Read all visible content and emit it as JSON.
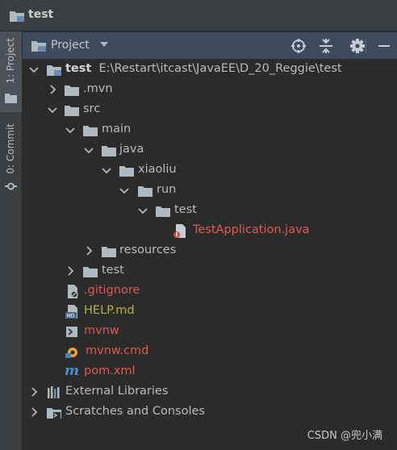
{
  "window": {
    "title": "test"
  },
  "sidebar": {
    "project_tab": "1: Project",
    "commit_tab": "0: Commit"
  },
  "panel": {
    "title": "Project"
  },
  "tree": {
    "root": {
      "label": "test",
      "path": "E:\\Restart\\itcast\\JavaEE\\D_20_Reggie\\test"
    },
    "mvn": ".mvn",
    "src": "src",
    "main": "main",
    "java": "java",
    "xiaoliu": "xiaoliu",
    "run": "run",
    "test_pkg": "test",
    "test_app": "TestApplication.java",
    "resources": "resources",
    "test_dir": "test",
    "gitignore": ".gitignore",
    "help": "HELP.md",
    "mvnw": "mvnw",
    "mvnw_cmd": "mvnw.cmd",
    "pom": "pom.xml",
    "ext_libs": "External Libraries",
    "scratches": "Scratches and Consoles"
  },
  "watermark": "CSDN @兜小满",
  "colors": {
    "accent": "#3d4b5c",
    "error_red": "#e05a4f",
    "modified_olive": "#b5b53a",
    "background": "#2b2b2b"
  }
}
